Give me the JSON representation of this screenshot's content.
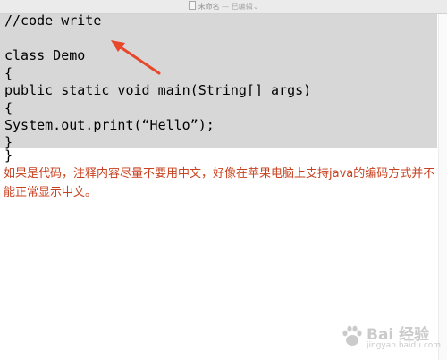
{
  "window": {
    "title": "未命名",
    "title_separator": " — ",
    "title_status": "已编辑"
  },
  "code": {
    "lines": [
      "//code write",
      "",
      "class Demo",
      "{",
      "public static void main(String[] args)",
      "{",
      "System.out.print(“Hello”);",
      "}"
    ],
    "last_line": "}"
  },
  "note": {
    "text": "如果是代码，注释内容尽量不要用中文，好像在苹果电脑上支持java的编码方式并不能正常显示中文。"
  },
  "watermark": {
    "brand": "Bai 经验",
    "url": "jingyan.baidu.com"
  },
  "colors": {
    "highlight": "#d7d7d7",
    "note": "#c8411f",
    "arrow": "#e8472a"
  },
  "icons": {
    "document": "document-icon",
    "dropdown": "chevron-down-icon",
    "annotation": "arrow-icon",
    "watermark_logo": "baidu-paw-icon"
  }
}
